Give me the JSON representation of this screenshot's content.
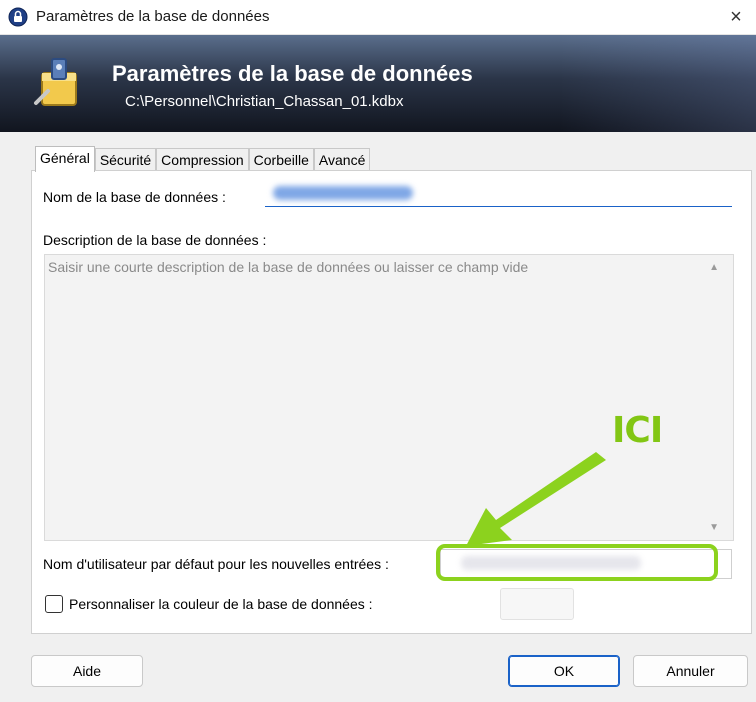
{
  "window": {
    "title": "Paramètres de la base de données",
    "close_glyph": "×"
  },
  "banner": {
    "title": "Paramètres de la base de données",
    "subtitle": "C:\\Personnel\\Christian_Chassan_01.kdbx"
  },
  "tabs": [
    {
      "label": "Général",
      "active": true
    },
    {
      "label": "Sécurité",
      "active": false
    },
    {
      "label": "Compression",
      "active": false
    },
    {
      "label": "Corbeille",
      "active": false
    },
    {
      "label": "Avancé",
      "active": false
    }
  ],
  "general": {
    "db_name_label": "Nom de la base de données :",
    "description_label": "Description de la base de données :",
    "description_placeholder": "Saisir une courte description de la base de données ou laisser ce champ vide",
    "default_user_label": "Nom d'utilisateur par défaut pour les nouvelles entrées :",
    "custom_color_label": "Personnaliser la couleur de la base de données :"
  },
  "buttons": {
    "help": "Aide",
    "ok": "OK",
    "cancel": "Annuler"
  },
  "annotation": {
    "text": "ICI",
    "color": "#8cd21e"
  },
  "icons": {
    "app": "keepass-lock-icon",
    "banner": "database-settings-icon",
    "scroll_up": "▲",
    "scroll_down": "▼"
  }
}
